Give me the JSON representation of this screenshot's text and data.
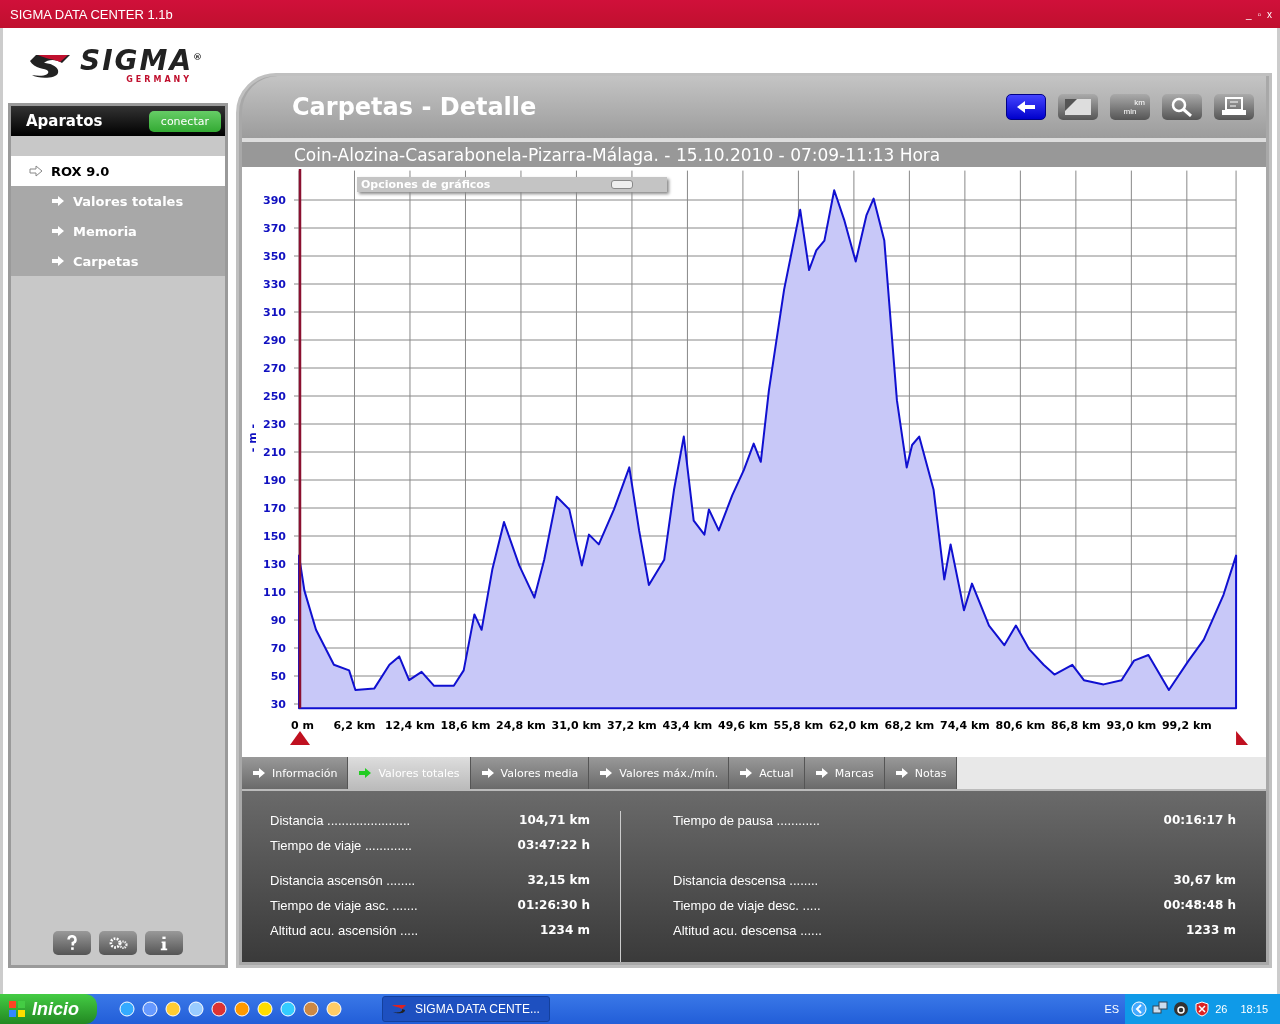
{
  "window": {
    "title": "SIGMA DATA CENTER 1.1b",
    "controls": [
      "_",
      "▫",
      "x"
    ]
  },
  "logo": {
    "brand": "SIGMA$^{®}$",
    "tagline": "GERMANY"
  },
  "sidebar": {
    "header": "Aparatos",
    "connect_button": "conectar",
    "items": [
      {
        "label": "ROX 9.0",
        "selected": true,
        "children": [
          {
            "label": "Valores totales",
            "selected": false
          },
          {
            "label": "Memoria",
            "selected": false
          },
          {
            "label": "Carpetas",
            "selected": false
          }
        ]
      }
    ]
  },
  "header": {
    "title": "Carpetas - Detalle",
    "toolbar": [
      {
        "kind": "back",
        "selected": true
      },
      {
        "kind": "chart",
        "selected": false
      },
      {
        "kind": "units",
        "selected": false,
        "labels": [
          "km",
          "min"
        ]
      },
      {
        "kind": "zoom",
        "selected": false
      },
      {
        "kind": "print",
        "selected": false
      }
    ]
  },
  "subtitle": "Coin-Alozina-Casarabonela-Pizarra-Málaga. - 15.10.2010 - 07:09-11:13 Hora",
  "chart_options": {
    "title": "Opciones de gráficos"
  },
  "chart": {
    "chart_data": {
      "type": "area",
      "grid": true,
      "ylabel": "- m -",
      "xlim": [
        0,
        104.7
      ],
      "ylim": [
        27,
        411
      ],
      "x": [
        0,
        0.6,
        1.9,
        3.9,
        5.6,
        6.3,
        8.4,
        10.1,
        11.2,
        12.3,
        13.7,
        15.1,
        17.3,
        18.4,
        19.6,
        20.4,
        21.6,
        22.9,
        24.6,
        26.3,
        27.4,
        28.8,
        30.2,
        31.6,
        32.4,
        33.5,
        35.2,
        36.9,
        38.0,
        39.1,
        40.8,
        41.9,
        43.0,
        44.1,
        45.3,
        45.8,
        46.9,
        48.4,
        49.7,
        50.8,
        51.6,
        52.5,
        54.2,
        56.0,
        57.0,
        57.8,
        58.7,
        59.8,
        60.9,
        62.2,
        63.4,
        64.2,
        65.4,
        66.8,
        67.9,
        68.5,
        69.3,
        70.9,
        72.1,
        72.8,
        74.3,
        75.2,
        77.1,
        78.8,
        80.1,
        81.6,
        83.2,
        84.4,
        86.4,
        87.7,
        89.9,
        91.9,
        93.3,
        94.9,
        97.2,
        99.4,
        101.1,
        103.3,
        104.7
      ],
      "series": [
        {
          "color": "#1010d0",
          "values": [
            136,
            111,
            83,
            58,
            54,
            40,
            41,
            58,
            64,
            47,
            53,
            43,
            43,
            54,
            94,
            83,
            126,
            160,
            129,
            106,
            133,
            178,
            169,
            129,
            151,
            144,
            169,
            199,
            154,
            115,
            133,
            183,
            221,
            161,
            151,
            169,
            154,
            179,
            197,
            216,
            203,
            254,
            326,
            383,
            340,
            354,
            361,
            397,
            376,
            346,
            379,
            391,
            361,
            247,
            199,
            215,
            221,
            183,
            119,
            144,
            97,
            116,
            86,
            72,
            86,
            69,
            58,
            51,
            58,
            47,
            44,
            47,
            61,
            65,
            40,
            61,
            76,
            108,
            136
          ]
        }
      ],
      "xticks": [
        {
          "value": 0,
          "label": "0 m"
        },
        {
          "value": 6.2,
          "label": "6,2 km"
        },
        {
          "value": 12.4,
          "label": "12,4 km"
        },
        {
          "value": 18.6,
          "label": "18,6 km"
        },
        {
          "value": 24.8,
          "label": "24,8 km"
        },
        {
          "value": 31.0,
          "label": "31,0 km"
        },
        {
          "value": 37.2,
          "label": "37,2 km"
        },
        {
          "value": 43.4,
          "label": "43,4 km"
        },
        {
          "value": 49.6,
          "label": "49,6 km"
        },
        {
          "value": 55.8,
          "label": "55,8 km"
        },
        {
          "value": 62.0,
          "label": "62,0 km"
        },
        {
          "value": 68.2,
          "label": "68,2 km"
        },
        {
          "value": 74.4,
          "label": "74,4 km"
        },
        {
          "value": 80.6,
          "label": "80,6 km"
        },
        {
          "value": 86.8,
          "label": "86,8 km"
        },
        {
          "value": 93.0,
          "label": "93,0 km"
        },
        {
          "value": 99.2,
          "label": "99,2 km"
        }
      ],
      "yticks": [
        30,
        50,
        70,
        90,
        110,
        130,
        150,
        170,
        190,
        210,
        230,
        250,
        270,
        290,
        310,
        330,
        350,
        370,
        390
      ]
    }
  },
  "tabs": [
    {
      "label": "Información",
      "selected": false
    },
    {
      "label": "Valores totales",
      "selected": true
    },
    {
      "label": "Valores media",
      "selected": false
    },
    {
      "label": "Valores máx./mín.",
      "selected": false
    },
    {
      "label": "Actual",
      "selected": false
    },
    {
      "label": "Marcas",
      "selected": false
    },
    {
      "label": "Notas",
      "selected": false
    }
  ],
  "stats": [
    {
      "groups": [
        {
          "rows": [
            {
              "label": "Distancia  .......................",
              "value": "104,71 km"
            },
            {
              "label": "Tiempo de viaje .............",
              "value": "03:47:22 h"
            }
          ]
        },
        {
          "rows": [
            {
              "label": "Distancia ascensón  ........",
              "value": "32,15 km"
            },
            {
              "label": "Tiempo de viaje asc. .......",
              "value": "01:26:30 h"
            },
            {
              "label": "Altitud acu. ascensión .....",
              "value": "1234 m"
            }
          ]
        }
      ]
    },
    {
      "groups": [
        {
          "rows": [
            {
              "label": "Tiempo de pausa ............",
              "value": "00:16:17 h"
            }
          ]
        },
        {
          "rows": [
            {
              "label": "Distancia descensa  ........",
              "value": "30,67 km"
            },
            {
              "label": "Tiempo de viaje desc. .....",
              "value": "00:48:48 h"
            },
            {
              "label": "Altitud acu. descensa ......",
              "value": "1233 m"
            }
          ]
        }
      ]
    }
  ],
  "taskbar": {
    "start": "Inicio",
    "task": "SIGMA DATA CENTE...",
    "language": "ES",
    "tray_number": "26",
    "clock": "18:15"
  }
}
